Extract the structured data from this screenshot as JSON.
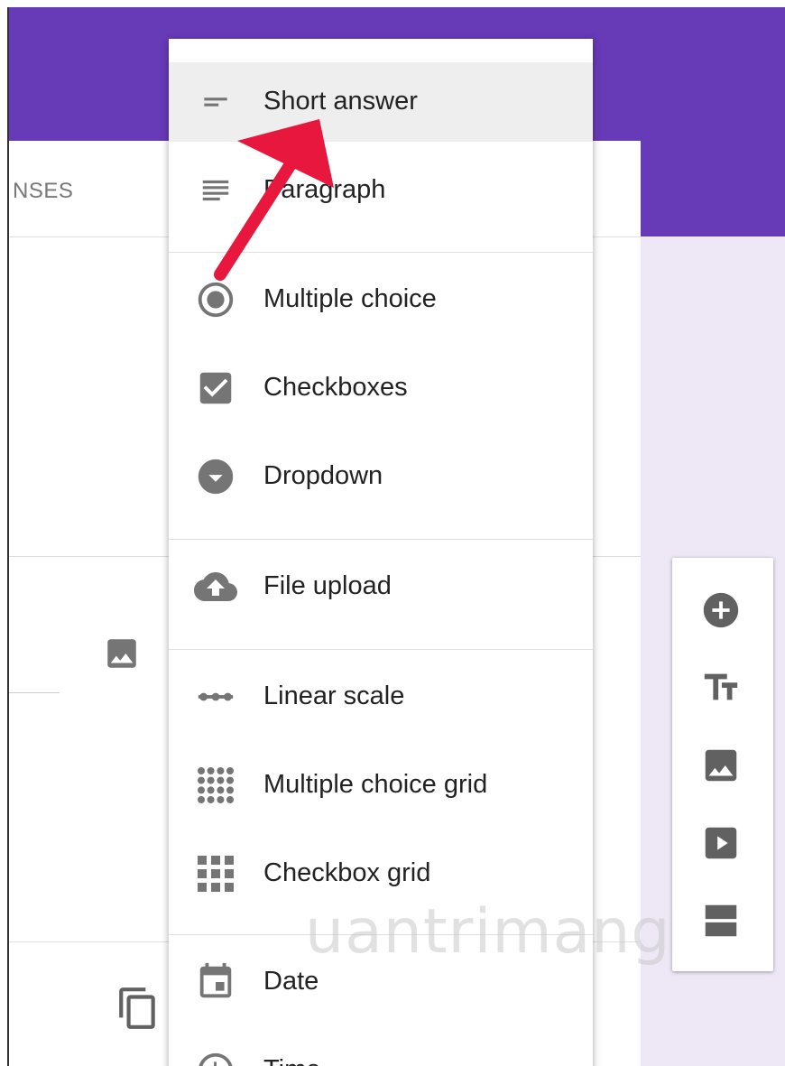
{
  "tabs": {
    "responses_label": "NSES"
  },
  "menu": {
    "items": [
      {
        "label": "Short answer",
        "icon": "short-answer-icon",
        "selected": true
      },
      {
        "label": "Paragraph",
        "icon": "paragraph-icon"
      },
      {
        "label": "Multiple choice",
        "icon": "radio-button-icon"
      },
      {
        "label": "Checkboxes",
        "icon": "checkbox-icon"
      },
      {
        "label": "Dropdown",
        "icon": "dropdown-icon"
      },
      {
        "label": "File upload",
        "icon": "cloud-upload-icon"
      },
      {
        "label": "Linear scale",
        "icon": "linear-scale-icon"
      },
      {
        "label": "Multiple choice grid",
        "icon": "radio-grid-icon"
      },
      {
        "label": "Checkbox grid",
        "icon": "checkbox-grid-icon"
      },
      {
        "label": "Date",
        "icon": "calendar-icon"
      },
      {
        "label": "Time",
        "icon": "clock-icon"
      }
    ]
  },
  "toolbar": {
    "items": [
      "add-question-icon",
      "title-text-icon",
      "image-icon",
      "video-icon",
      "section-icon"
    ]
  },
  "watermark": {
    "text": "uantrimang"
  },
  "colors": {
    "header": "#673ab7",
    "background": "#ede7f6",
    "icon": "#757575",
    "arrow": "#e8173d"
  }
}
